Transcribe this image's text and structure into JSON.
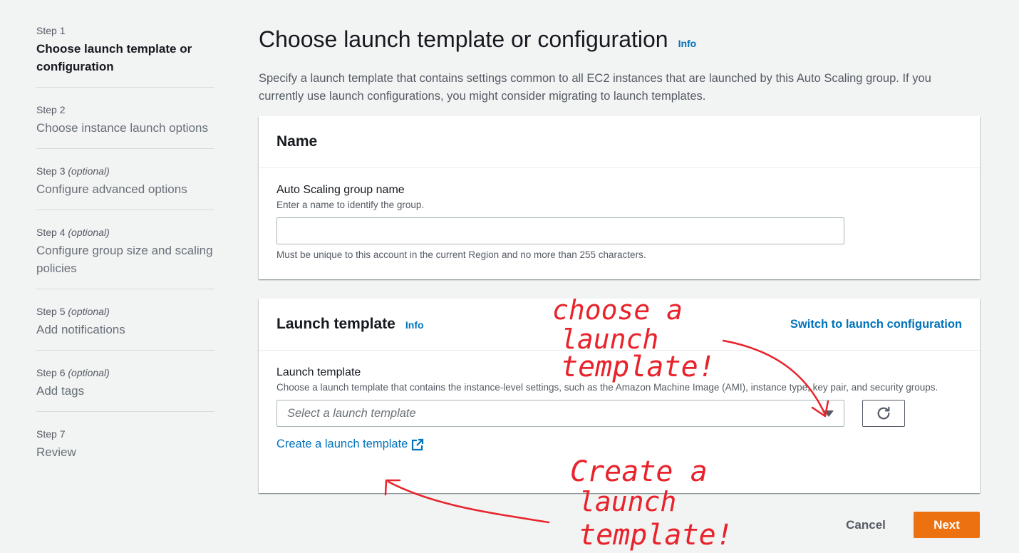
{
  "steps": [
    {
      "num": "Step 1",
      "optional": "",
      "title": "Choose launch template or configuration"
    },
    {
      "num": "Step 2",
      "optional": "",
      "title": "Choose instance launch options"
    },
    {
      "num": "Step 3",
      "optional": "(optional)",
      "title": "Configure advanced options"
    },
    {
      "num": "Step 4",
      "optional": "(optional)",
      "title": "Configure group size and scaling policies"
    },
    {
      "num": "Step 5",
      "optional": "(optional)",
      "title": "Add notifications"
    },
    {
      "num": "Step 6",
      "optional": "(optional)",
      "title": "Add tags"
    },
    {
      "num": "Step 7",
      "optional": "",
      "title": "Review"
    }
  ],
  "page": {
    "title": "Choose launch template or configuration",
    "info": "Info",
    "description": "Specify a launch template that contains settings common to all EC2 instances that are launched by this Auto Scaling group. If you currently use launch configurations, you might consider migrating to launch templates."
  },
  "name_panel": {
    "title": "Name",
    "field_label": "Auto Scaling group name",
    "field_desc": "Enter a name to identify the group.",
    "value": "",
    "constraint": "Must be unique to this account in the current Region and no more than 255 characters."
  },
  "launch_panel": {
    "title": "Launch template",
    "info": "Info",
    "switch_link": "Switch to launch configuration",
    "field_label": "Launch template",
    "field_desc": "Choose a launch template that contains the instance-level settings, such as the Amazon Machine Image (AMI), instance type, key pair, and security groups.",
    "placeholder": "Select a launch template",
    "create_link": "Create a launch template"
  },
  "footer": {
    "cancel": "Cancel",
    "next": "Next"
  },
  "annotations": {
    "choose": [
      "choose a",
      "launch",
      "template!"
    ],
    "create": [
      "Create a",
      "launch",
      "template!"
    ]
  },
  "icons": {
    "refresh": "refresh-icon",
    "external": "external-link-icon",
    "caret": "caret-down-icon"
  },
  "colors": {
    "link": "#0073bb",
    "primary": "#ec7211",
    "annotation": "#e8232b"
  }
}
